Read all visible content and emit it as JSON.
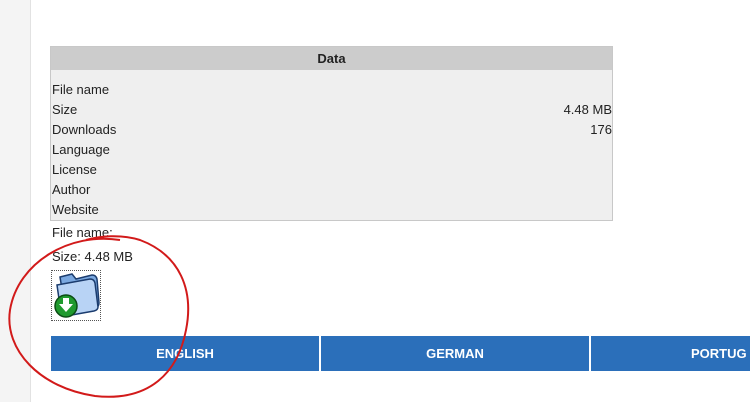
{
  "data_panel": {
    "title": "Data",
    "rows": [
      {
        "label": "File name",
        "value": ""
      },
      {
        "label": "Size",
        "value": "4.48 MB"
      },
      {
        "label": "Downloads",
        "value": "176"
      },
      {
        "label": "Language",
        "value": ""
      },
      {
        "label": "License",
        "value": ""
      },
      {
        "label": "Author",
        "value": ""
      },
      {
        "label": "Website",
        "value": ""
      }
    ]
  },
  "file_info": {
    "file_name_line": "File name:",
    "size_line": "Size: 4.48 MB"
  },
  "download_icon": "folder-download-icon",
  "languages": [
    "ENGLISH",
    "GERMAN",
    "PORTUG"
  ],
  "colors": {
    "accent": "#2b6fba",
    "annotation": "#d21a1a"
  }
}
